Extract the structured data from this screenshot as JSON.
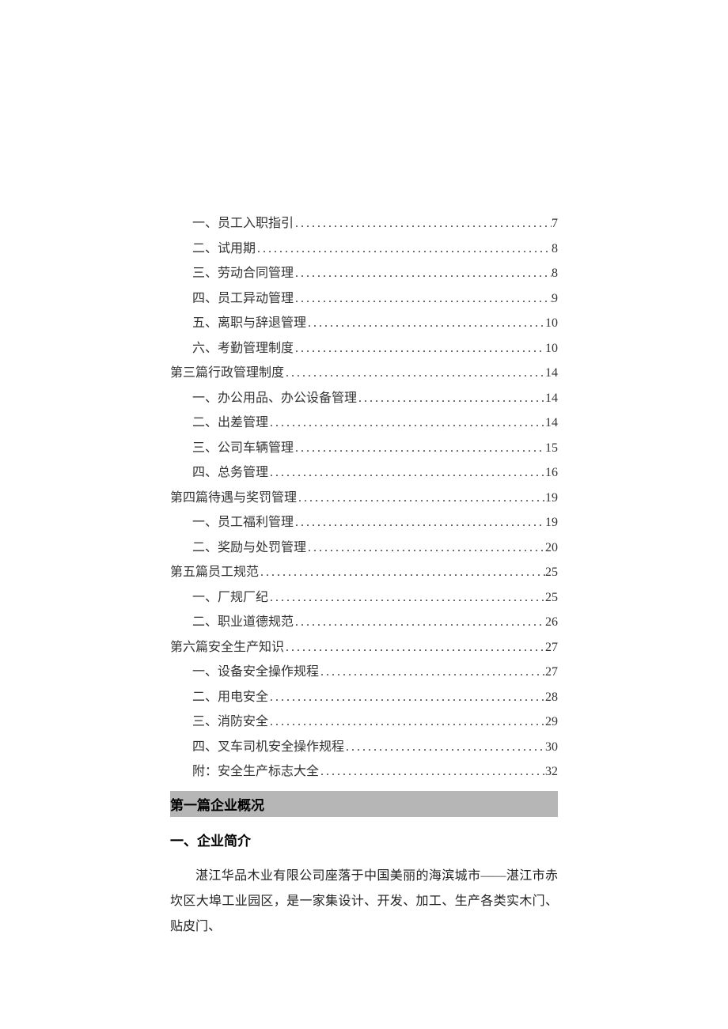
{
  "toc": [
    {
      "indent": 1,
      "label": "一、员工入职指引",
      "page": "7"
    },
    {
      "indent": 1,
      "label": "二、试用期",
      "page": "8"
    },
    {
      "indent": 1,
      "label": "三、劳动合同管理",
      "page": "8"
    },
    {
      "indent": 1,
      "label": "四、员工异动管理",
      "page": "9"
    },
    {
      "indent": 1,
      "label": "五、离职与辞退管理",
      "page": "10"
    },
    {
      "indent": 1,
      "label": "六、考勤管理制度",
      "page": "10"
    },
    {
      "indent": 0,
      "label": "第三篇行政管理制度",
      "page": "14"
    },
    {
      "indent": 1,
      "label": "一、办公用品、办公设备管理",
      "page": "14"
    },
    {
      "indent": 1,
      "label": "二、出差管理",
      "page": "14"
    },
    {
      "indent": 1,
      "label": "三、公司车辆管理",
      "page": "15"
    },
    {
      "indent": 1,
      "label": "四、总务管理",
      "page": "16"
    },
    {
      "indent": 0,
      "label": "第四篇待遇与奖罚管理",
      "page": "19"
    },
    {
      "indent": 1,
      "label": "一、员工福利管理",
      "page": "19"
    },
    {
      "indent": 1,
      "label": "二、奖励与处罚管理",
      "page": "20"
    },
    {
      "indent": 0,
      "label": "第五篇员工规范",
      "page": "25"
    },
    {
      "indent": 1,
      "label": "一、厂规厂纪",
      "page": "25"
    },
    {
      "indent": 1,
      "label": "二、职业道德规范",
      "page": "26"
    },
    {
      "indent": 0,
      "label": "第六篇安全生产知识",
      "page": "27"
    },
    {
      "indent": 1,
      "label": "一、设备安全操作规程",
      "page": "27"
    },
    {
      "indent": 1,
      "label": "二、用电安全",
      "page": "28"
    },
    {
      "indent": 1,
      "label": "三、消防安全",
      "page": "29"
    },
    {
      "indent": 1,
      "label": "四、叉车司机安全操作规程",
      "page": "30"
    },
    {
      "indent": 1,
      "label": "附：安全生产标志大全",
      "page": "32"
    }
  ],
  "section_bar": "第一篇企业概况",
  "subheading": "一、企业简介",
  "body": "湛江华品木业有限公司座落于中国美丽的海滨城市——湛江市赤坎区大埠工业园区，是一家集设计、开发、加工、生产各类实木门、贴皮门、"
}
